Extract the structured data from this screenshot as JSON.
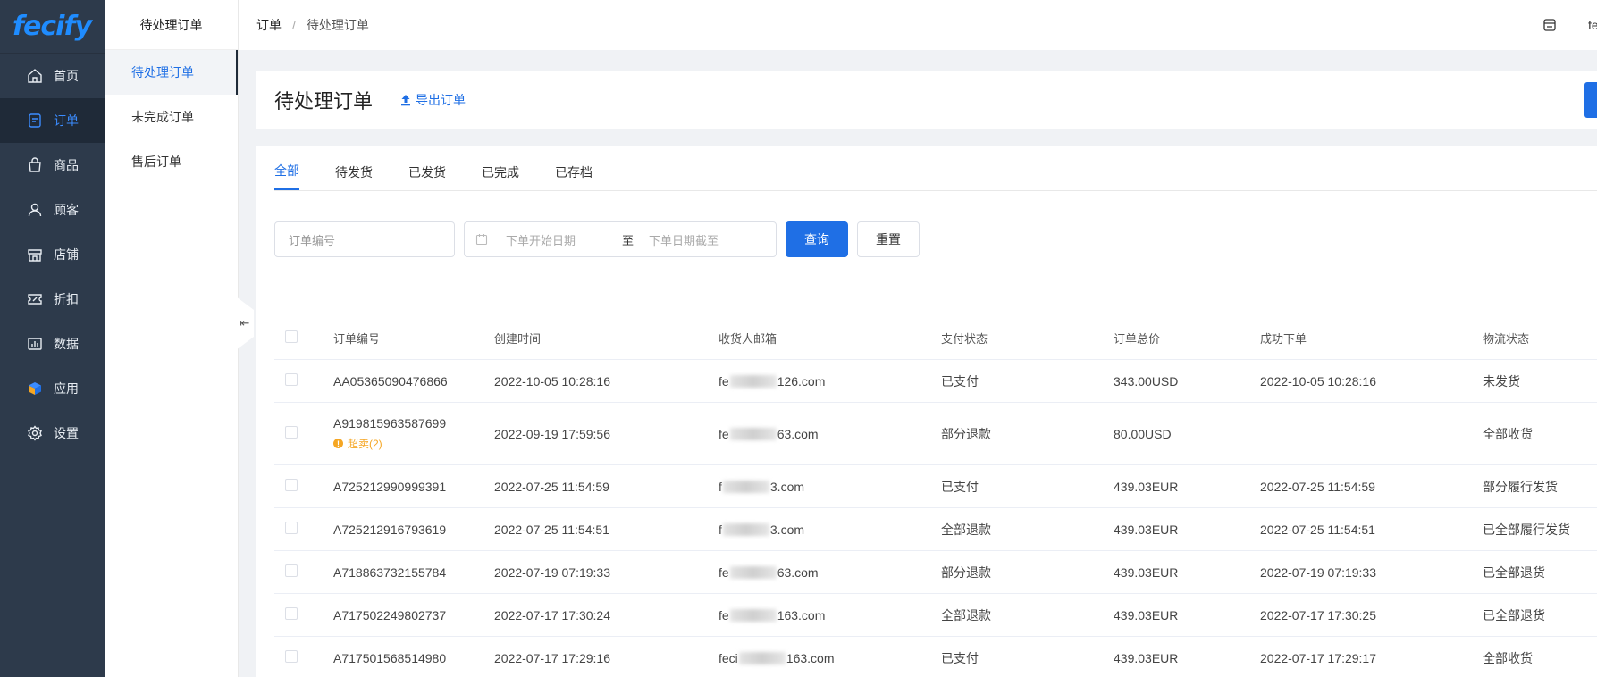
{
  "app": {
    "logo_main": "fecify"
  },
  "sidebar": {
    "items": [
      {
        "label": "首页",
        "icon": "home-icon"
      },
      {
        "label": "订单",
        "icon": "order-icon",
        "active": true
      },
      {
        "label": "商品",
        "icon": "bag-icon"
      },
      {
        "label": "顾客",
        "icon": "user-icon"
      },
      {
        "label": "店铺",
        "icon": "store-icon"
      },
      {
        "label": "折扣",
        "icon": "coupon-icon"
      },
      {
        "label": "数据",
        "icon": "chart-icon"
      },
      {
        "label": "应用",
        "icon": "app-icon"
      },
      {
        "label": "设置",
        "icon": "gear-icon"
      }
    ]
  },
  "subnav": {
    "title": "待处理订单",
    "items": [
      {
        "label": "待处理订单",
        "active": true
      },
      {
        "label": "未完成订单"
      },
      {
        "label": "售后订单"
      }
    ]
  },
  "breadcrumb": {
    "root": "订单",
    "sep": "/",
    "current": "待处理订单"
  },
  "topbar": {
    "user_initial": "fe"
  },
  "page": {
    "title": "待处理订单",
    "export_label": "导出订单"
  },
  "tabs": [
    "全部",
    "待发货",
    "已发货",
    "已完成",
    "已存档"
  ],
  "filters": {
    "order_placeholder": "订单编号",
    "date_start_placeholder": "下单开始日期",
    "date_sep": "至",
    "date_end_placeholder": "下单日期截至",
    "search_label": "查询",
    "reset_label": "重置"
  },
  "table": {
    "headers": [
      "订单编号",
      "创建时间",
      "收货人邮箱",
      "支付状态",
      "订单总价",
      "成功下单",
      "物流状态"
    ],
    "rows": [
      {
        "id": "AA05365090476866",
        "created": "2022-10-05 10:28:16",
        "email_pre": "fe",
        "email_post": "126.com",
        "pay": "已支付",
        "total": "343.00USD",
        "success": "2022-10-05 10:28:16",
        "ship": "未发货"
      },
      {
        "id": "A919815963587699",
        "tag": "超卖(2)",
        "created": "2022-09-19 17:59:56",
        "email_pre": "fe",
        "email_post": "63.com",
        "pay": "部分退款",
        "total": "80.00USD",
        "success": "",
        "ship": "全部收货"
      },
      {
        "id": "A725212990999391",
        "created": "2022-07-25 11:54:59",
        "email_pre": "f",
        "email_post": "3.com",
        "pay": "已支付",
        "total": "439.03EUR",
        "success": "2022-07-25 11:54:59",
        "ship": "部分履行发货"
      },
      {
        "id": "A725212916793619",
        "created": "2022-07-25 11:54:51",
        "email_pre": "f",
        "email_post": "3.com",
        "pay": "全部退款",
        "total": "439.03EUR",
        "success": "2022-07-25 11:54:51",
        "ship": "已全部履行发货"
      },
      {
        "id": "A718863732155784",
        "created": "2022-07-19 07:19:33",
        "email_pre": "fe",
        "email_post": "63.com",
        "pay": "部分退款",
        "total": "439.03EUR",
        "success": "2022-07-19 07:19:33",
        "ship": "已全部退货"
      },
      {
        "id": "A717502249802737",
        "created": "2022-07-17 17:30:24",
        "email_pre": "fe",
        "email_post": "163.com",
        "pay": "全部退款",
        "total": "439.03EUR",
        "success": "2022-07-17 17:30:25",
        "ship": "已全部退货"
      },
      {
        "id": "A717501568514980",
        "created": "2022-07-17 17:29:16",
        "email_pre": "feci",
        "email_post": "163.com",
        "pay": "已支付",
        "total": "439.03EUR",
        "success": "2022-07-17 17:29:17",
        "ship": "全部收货"
      }
    ]
  },
  "colors": {
    "primary": "#1f6fe5",
    "sidebar_bg": "#2d3a4b",
    "warning": "#f5a623"
  }
}
